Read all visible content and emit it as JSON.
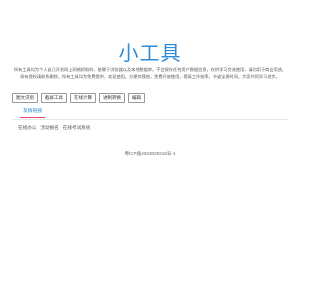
{
  "header": {
    "title": "小工具"
  },
  "intro": {
    "text": "所有工具均为个人自己开发网上网络抓取的，依赖于浏览器以及本地数据库。不会保存任何用户数据信息，仅供学习交流使用，请勿用于商业用途。如有侵权请联系删除，所有工具均为免费提供，欢迎使用。方便你我他，免费开放使用，提高工作效率，节省宝贵时间，大家共同学习进步。"
  },
  "tools": [
    {
      "label": "图文识别"
    },
    {
      "label": "截屏工具"
    },
    {
      "label": "在线计算"
    },
    {
      "label": "进制转换"
    },
    {
      "label": "编辑"
    }
  ],
  "friend_links": {
    "tab_label": "友情链接",
    "items": [
      {
        "label": "在线办公"
      },
      {
        "label": "活动报名"
      },
      {
        "label": "在线考试系统"
      }
    ]
  },
  "footer": {
    "icp": "粤ICP备2023029218号-1"
  }
}
